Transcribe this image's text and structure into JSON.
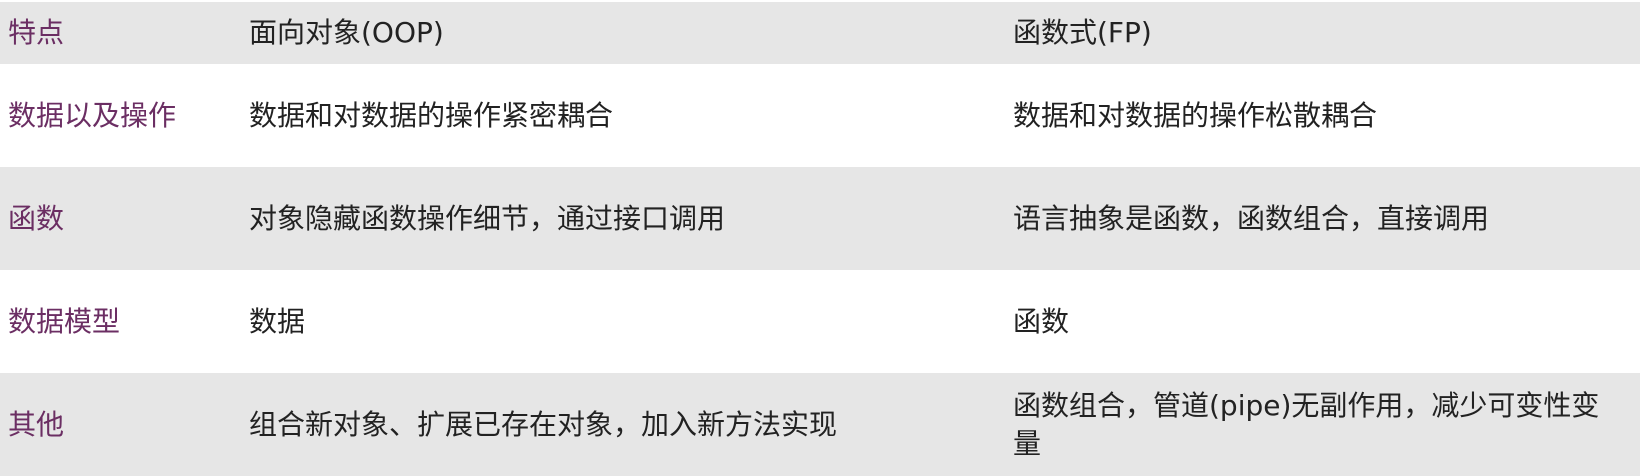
{
  "table": {
    "header": {
      "feature": "特点",
      "oop": "面向对象(OOP)",
      "fp": "函数式(FP)"
    },
    "rows": [
      {
        "feature": "数据以及操作",
        "oop": "数据和对数据的操作紧密耦合",
        "fp": "数据和对数据的操作松散耦合"
      },
      {
        "feature": "函数",
        "oop": "对象隐藏函数操作细节，通过接口调用",
        "fp": "语言抽象是函数，函数组合，直接调用"
      },
      {
        "feature": "数据模型",
        "oop": "数据",
        "fp": "函数"
      },
      {
        "feature": "其他",
        "oop": "组合新对象、扩展已存在对象，加入新方法实现",
        "fp": "函数组合，管道(pipe)无副作用，减少可变性变量"
      }
    ]
  },
  "colors": {
    "label": "#6b2e63",
    "shaded_row": "#e6e6e6",
    "text": "#222222"
  }
}
